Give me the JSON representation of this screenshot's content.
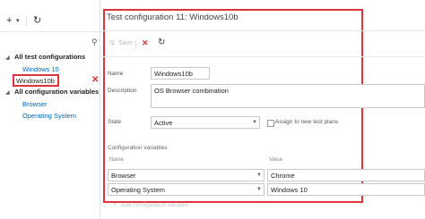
{
  "sidebar": {
    "toolbar": {
      "new_glyph": "+",
      "dropdown_glyph": "▾",
      "refresh_glyph": "↻"
    },
    "tree": {
      "group1": {
        "label": "All test configurations",
        "items": [
          "Windows 10",
          "Windows10b"
        ]
      },
      "group2": {
        "label": "All configuration variables",
        "items": [
          "Browser",
          "Operating System"
        ]
      }
    },
    "delete_glyph": "✕",
    "search_icon_glyph": "⚲"
  },
  "main": {
    "title": "Test configuration 11: Windows10b",
    "toolbar": {
      "save_label": "Save",
      "save_glyph": "🖫",
      "delete_glyph": "✕",
      "refresh_glyph": "↻"
    },
    "form": {
      "name_label": "Name",
      "name_value": "Windows10b",
      "description_label": "Description",
      "description_value": "OS Browser combination",
      "state_label": "State",
      "state_value": "Active",
      "assign_label": "Assign to new test plans",
      "assign_checked": false
    },
    "variables": {
      "section_label": "Configuration variables",
      "name_header": "Name",
      "value_header": "Value",
      "rows": [
        {
          "name": "Browser",
          "value": "Chrome"
        },
        {
          "name": "Operating System",
          "value": "Windows 10"
        }
      ],
      "add_label": "Add configuration variable"
    }
  },
  "colors": {
    "link": "#0063b1",
    "highlight": "#e0333b",
    "delete": "#d13438"
  }
}
